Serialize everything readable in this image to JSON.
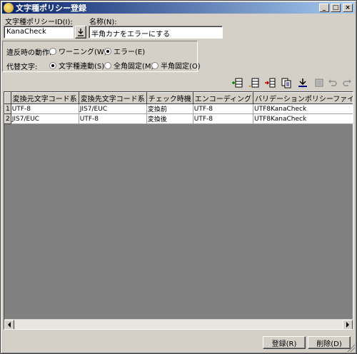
{
  "window": {
    "title": "文字種ポリシー登録",
    "controls": {
      "minimize": "_",
      "maximize": "□",
      "close": "×"
    }
  },
  "form": {
    "policy_id_label": "文字種ポリシーID(I):",
    "policy_id_value": "KanaCheck",
    "name_label": "名称(N):",
    "name_value": "半角カナをエラーにする",
    "violation_label": "違反時の動作:",
    "violation_options": [
      {
        "label": "ワーニング(W)",
        "selected": false
      },
      {
        "label": "エラー(E)",
        "selected": true
      }
    ],
    "substitute_label": "代替文字:",
    "substitute_options": [
      {
        "label": "文字種連動(S)",
        "selected": true
      },
      {
        "label": "全角固定(M)",
        "selected": false
      },
      {
        "label": "半角固定(O)",
        "selected": false
      }
    ]
  },
  "toolbar": {
    "icons": [
      "insert-row-icon",
      "append-row-icon",
      "insert-column-icon",
      "copy-icon",
      "download-icon",
      "delete-icon",
      "undo-icon",
      "redo-icon"
    ]
  },
  "table": {
    "columns": [
      "",
      "変換元文字コード系",
      "変換先文字コード系",
      "チェック時機",
      "エンコーディング",
      "バリデーションポリシーファイル名"
    ],
    "rows": [
      {
        "num": "1",
        "cells": [
          "UTF-8",
          "JIS7/EUC",
          "変換前",
          "UTF-8",
          "UTF8KanaCheck"
        ]
      },
      {
        "num": "2",
        "cells": [
          "JIS7/EUC",
          "UTF-8",
          "変換後",
          "UTF-8",
          "UTF8KanaCheck"
        ]
      }
    ]
  },
  "buttons": {
    "register": "登録(R)",
    "delete": "削除(D)"
  },
  "colors": {
    "titlebar_start": "#0a246a",
    "titlebar_end": "#a6caf0",
    "face": "#d4d0c8"
  }
}
